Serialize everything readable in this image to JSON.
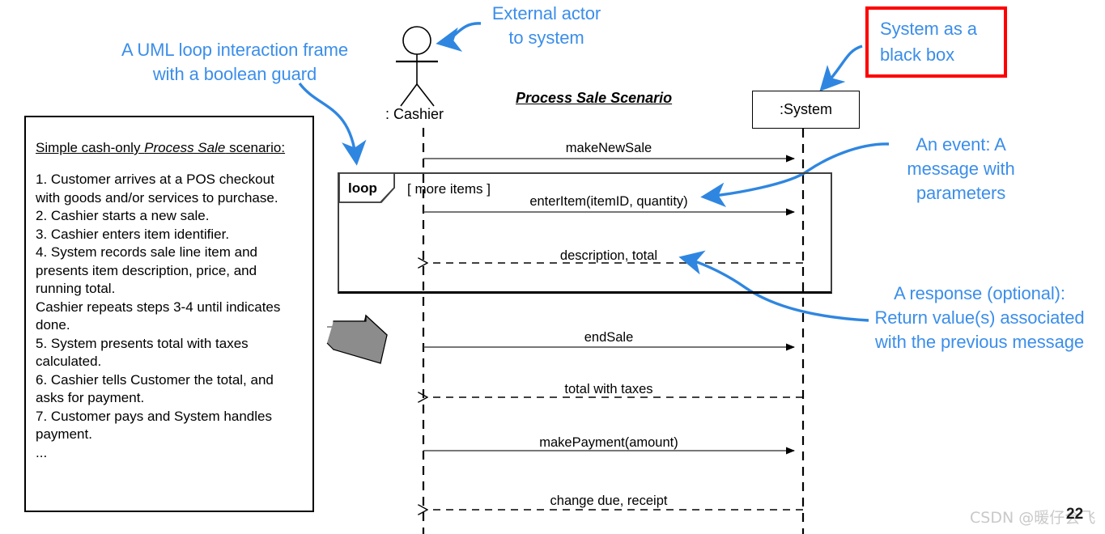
{
  "annotations": {
    "loop_frame_note": "A UML loop interaction frame\nwith a boolean guard",
    "external_actor_note": "External actor\nto system",
    "black_box_note": "System as a\nblack box",
    "event_note": "An event: A\nmessage with\nparameters",
    "response_note": "A response (optional):\nReturn value(s) associated\nwith the previous message"
  },
  "scenario": {
    "title_prefix": "Simple cash-only ",
    "title_italic": "Process Sale",
    "title_suffix": " scenario:",
    "body": "1. Customer arrives at a POS checkout\nwith goods and/or services to purchase.\n2. Cashier starts a new sale.\n3. Cashier enters item identifier.\n4. System records sale line item and\npresents item description, price, and\nrunning total.\nCashier repeats steps 3-4 until indicates\ndone.\n5. System presents total with taxes\ncalculated.\n6. Cashier tells Customer the total, and\nasks for payment.\n7. Customer pays and System handles\npayment.\n..."
  },
  "diagram": {
    "title": "Process Sale Scenario",
    "actor_label": ": Cashier",
    "system_label": ":System",
    "loop_tag": "loop",
    "loop_guard": "[ more items ]",
    "messages": [
      {
        "label": "makeNewSale",
        "kind": "call",
        "direction": "right"
      },
      {
        "label": "enterItem(itemID, quantity)",
        "kind": "call",
        "direction": "right"
      },
      {
        "label": "description, total",
        "kind": "return",
        "direction": "left"
      },
      {
        "label": "endSale",
        "kind": "call",
        "direction": "right"
      },
      {
        "label": "total with taxes",
        "kind": "return",
        "direction": "left"
      },
      {
        "label": "makePayment(amount)",
        "kind": "call",
        "direction": "right"
      },
      {
        "label": "change due, receipt",
        "kind": "return",
        "direction": "left"
      }
    ]
  },
  "footer": {
    "watermark": "CSDN @暖仔会飞",
    "page_number": "22"
  },
  "colors": {
    "annotation_blue": "#3b8eea",
    "highlight_red": "#ff0000",
    "line_black": "#000000",
    "arrow_gray": "#808080"
  }
}
